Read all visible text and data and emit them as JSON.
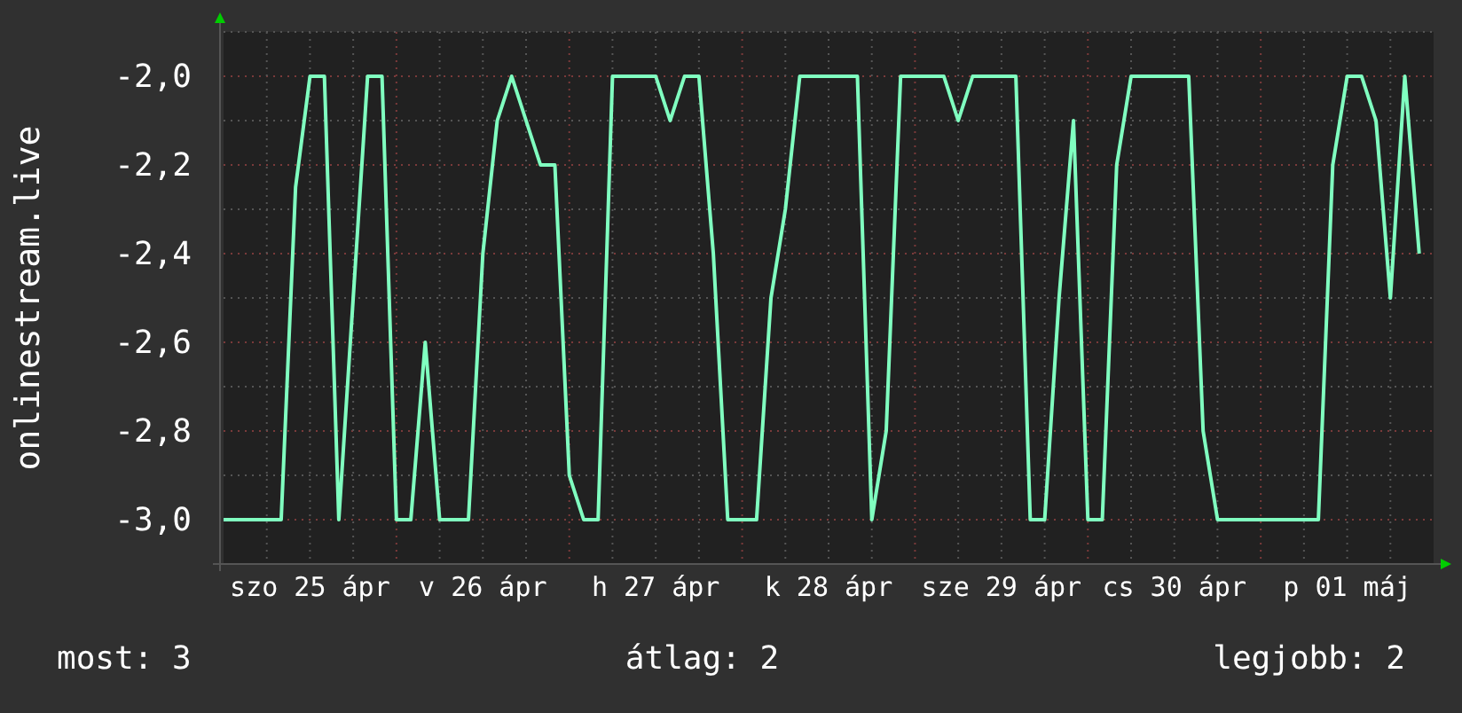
{
  "chart": {
    "chart_data": {
      "type": "line",
      "ylabel": "onlinestream.live",
      "categories": [
        null,
        null,
        null,
        null,
        null,
        null,
        "szo 25 ápr",
        null,
        null,
        null,
        null,
        null,
        null,
        null,
        null,
        null,
        null,
        null,
        "v 26 ápr",
        null,
        null,
        null,
        null,
        null,
        null,
        null,
        null,
        null,
        null,
        null,
        "h 27 ápr",
        null,
        null,
        null,
        null,
        null,
        null,
        null,
        null,
        null,
        null,
        null,
        "k 28 ápr",
        null,
        null,
        null,
        null,
        null,
        null,
        null,
        null,
        null,
        null,
        null,
        "sze 29 ápr",
        null,
        null,
        null,
        null,
        null,
        null,
        null,
        null,
        null,
        null,
        null,
        "cs 30 ápr",
        null,
        null,
        null,
        null,
        null,
        null,
        null,
        null,
        null,
        null,
        null,
        "p 01 máj",
        null,
        null,
        null,
        null,
        null
      ],
      "series": [
        {
          "color": "#80ffc0",
          "values": [
            -3,
            -3,
            -3,
            -3,
            -3,
            -2.25,
            -2,
            -2,
            -3,
            -2.5,
            -2,
            -2,
            -3,
            -3,
            -2.6,
            -3,
            -3,
            -3,
            -2.4,
            -2.1,
            -2,
            -2.1,
            -2.2,
            -2.2,
            -2.9,
            -3,
            -3,
            -2,
            -2,
            -2,
            -2,
            -2.1,
            -2,
            -2,
            -2.4,
            -3,
            -3,
            -3,
            -2.5,
            -2.3,
            -2,
            -2,
            -2,
            -2,
            -2,
            -3,
            -2.8,
            -2,
            -2,
            -2,
            -2,
            -2.1,
            -2,
            -2,
            -2,
            -2,
            -3,
            -3,
            -2.5,
            -2.1,
            -3,
            -3,
            -2.2,
            -2,
            -2,
            -2,
            -2,
            -2,
            -2.8,
            -3,
            -3,
            -3,
            -3,
            -3,
            -3,
            -3,
            -3,
            -2.2,
            -2,
            -2,
            -2.1,
            -2.5,
            -2,
            -2.4
          ]
        }
      ],
      "ylim": [
        -3.1,
        -1.9
      ],
      "grid": true,
      "yticks": [
        {
          "value": -3,
          "label": "-3,0"
        },
        {
          "value": -2.8,
          "label": "-2,8"
        },
        {
          "value": -2.6,
          "label": "-2,6"
        },
        {
          "value": -2.4,
          "label": "-2,4"
        },
        {
          "value": -2.2,
          "label": "-2,2"
        },
        {
          "value": -2,
          "label": "-2,0"
        }
      ]
    }
  },
  "legend": [
    "most: 3",
    "átlag: 2",
    "legjobb: 2"
  ]
}
